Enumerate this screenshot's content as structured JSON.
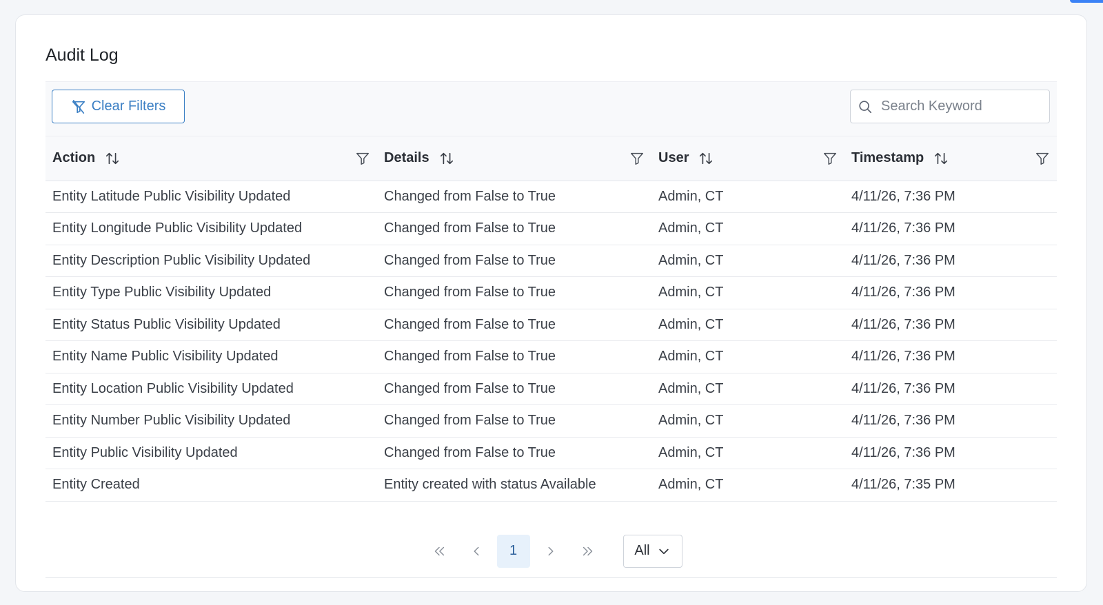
{
  "page": {
    "title": "Audit Log"
  },
  "toolbar": {
    "clear_filters_label": "Clear Filters",
    "search_placeholder": "Search Keyword",
    "search_value": ""
  },
  "table": {
    "columns": [
      {
        "label": "Action"
      },
      {
        "label": "Details"
      },
      {
        "label": "User"
      },
      {
        "label": "Timestamp"
      }
    ],
    "rows": [
      {
        "action": "Entity Latitude Public Visibility Updated",
        "details": "Changed from False to True",
        "user": "Admin, CT",
        "timestamp": "4/11/26, 7:36 PM"
      },
      {
        "action": "Entity Longitude Public Visibility Updated",
        "details": "Changed from False to True",
        "user": "Admin, CT",
        "timestamp": "4/11/26, 7:36 PM"
      },
      {
        "action": "Entity Description Public Visibility Updated",
        "details": "Changed from False to True",
        "user": "Admin, CT",
        "timestamp": "4/11/26, 7:36 PM"
      },
      {
        "action": "Entity Type Public Visibility Updated",
        "details": "Changed from False to True",
        "user": "Admin, CT",
        "timestamp": "4/11/26, 7:36 PM"
      },
      {
        "action": "Entity Status Public Visibility Updated",
        "details": "Changed from False to True",
        "user": "Admin, CT",
        "timestamp": "4/11/26, 7:36 PM"
      },
      {
        "action": "Entity Name Public Visibility Updated",
        "details": "Changed from False to True",
        "user": "Admin, CT",
        "timestamp": "4/11/26, 7:36 PM"
      },
      {
        "action": "Entity Location Public Visibility Updated",
        "details": "Changed from False to True",
        "user": "Admin, CT",
        "timestamp": "4/11/26, 7:36 PM"
      },
      {
        "action": "Entity Number Public Visibility Updated",
        "details": "Changed from False to True",
        "user": "Admin, CT",
        "timestamp": "4/11/26, 7:36 PM"
      },
      {
        "action": "Entity Public Visibility Updated",
        "details": "Changed from False to True",
        "user": "Admin, CT",
        "timestamp": "4/11/26, 7:36 PM"
      },
      {
        "action": "Entity Created",
        "details": "Entity created with status Available",
        "user": "Admin, CT",
        "timestamp": "4/11/26, 7:35 PM"
      }
    ]
  },
  "pagination": {
    "first": "«",
    "prev": "‹",
    "current_page": "1",
    "next": "›",
    "last": "»",
    "rows_per_page": "All"
  },
  "colors": {
    "accent": "#3b7fc4",
    "corner_accent": "#3b82f6",
    "active_page_bg": "#e7f1fb"
  },
  "icons": {
    "clear_filters": "filter-slash-icon",
    "search": "search-icon",
    "sort": "sort-icon",
    "column_filter": "filter-icon",
    "rows_dropdown": "chevron-down-icon"
  }
}
